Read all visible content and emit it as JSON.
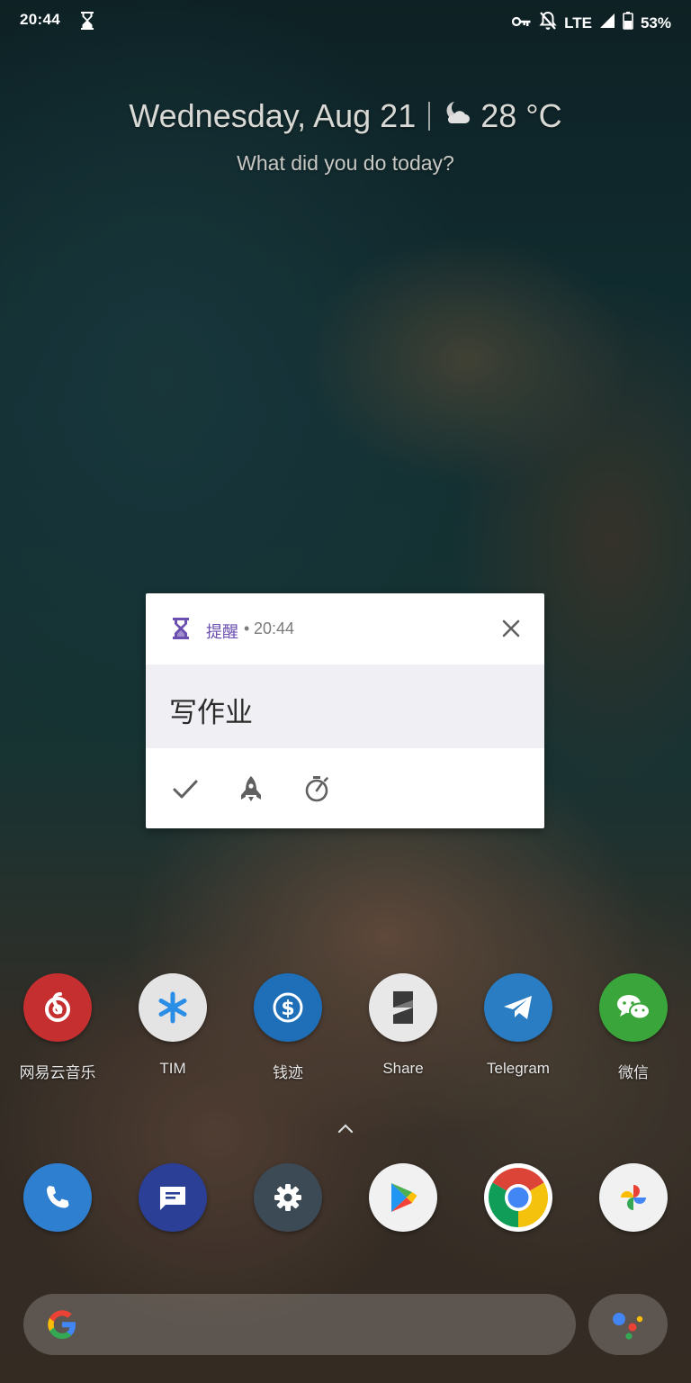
{
  "status_bar": {
    "time": "20:44",
    "network": "LTE",
    "battery": "53%",
    "icons": [
      "hourglass-icon",
      "vpn-key-icon",
      "notifications-off-icon",
      "signal-icon",
      "battery-icon"
    ]
  },
  "header": {
    "date": "Wednesday, Aug 21",
    "weather_icon": "moon-cloud-icon",
    "temperature": "28 °C",
    "subtitle": "What did you do today?"
  },
  "notification": {
    "app_name": "提醒",
    "separator": "•",
    "time": "20:44",
    "title": "写作业",
    "app_color": "#6a4fb0",
    "actions": [
      "check-icon",
      "rocket-icon",
      "timer-icon"
    ]
  },
  "apps": [
    {
      "label": "网易云音乐",
      "color": "#c62f2f",
      "icon": "netease-music-icon"
    },
    {
      "label": "TIM",
      "color": "#e4e4e4",
      "icon": "tim-icon"
    },
    {
      "label": "钱迹",
      "color": "#1e6fb8",
      "icon": "qianji-icon"
    },
    {
      "label": "Share",
      "color": "#e8e8e8",
      "icon": "share-icon"
    },
    {
      "label": "Telegram",
      "color": "#2a7dc2",
      "icon": "telegram-icon"
    },
    {
      "label": "微信",
      "color": "#3aa53a",
      "icon": "wechat-icon"
    }
  ],
  "dock": [
    {
      "name": "phone",
      "color": "#2f7fd0",
      "icon": "phone-icon"
    },
    {
      "name": "messages",
      "color": "#2c3f96",
      "icon": "messages-icon"
    },
    {
      "name": "settings",
      "color": "#3c4a55",
      "icon": "settings-icon"
    },
    {
      "name": "play-store",
      "color": "#f1f1f1",
      "icon": "play-store-icon"
    },
    {
      "name": "chrome",
      "color": "#ffffff",
      "icon": "chrome-icon"
    },
    {
      "name": "photos",
      "color": "#f1f1f1",
      "icon": "photos-icon"
    }
  ],
  "search": {
    "icon": "google-g-icon",
    "assistant_icon": "assistant-icon"
  }
}
